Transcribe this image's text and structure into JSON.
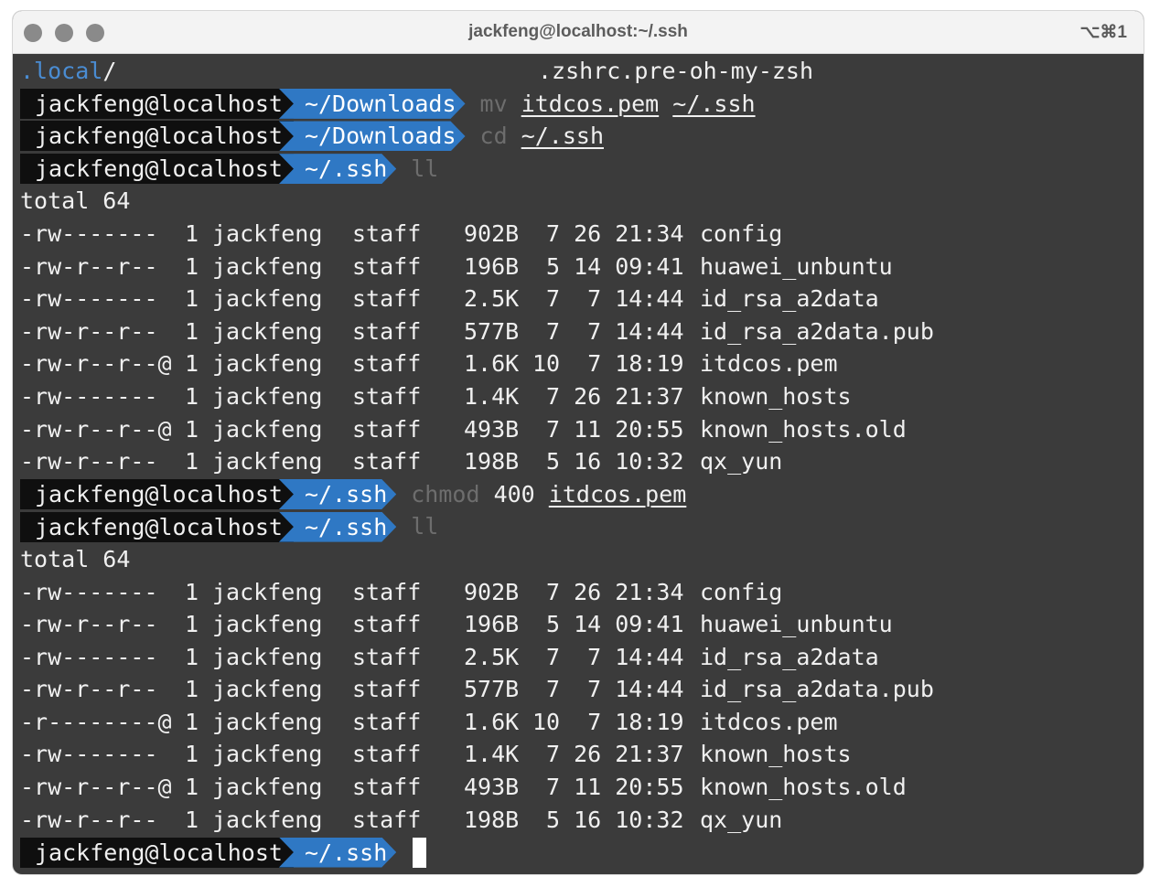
{
  "window": {
    "title": "jackfeng@localhost:~/.ssh",
    "shortcut": "⌥⌘1"
  },
  "colors": {
    "terminal_bg": "#3b3b3b",
    "prompt_user_bg": "#0f0f0f",
    "prompt_path_bg": "#2f78c4",
    "dim_command": "#6d6d6d"
  },
  "terminal": {
    "top_line": {
      "left": ".local",
      "left_slash": "/",
      "right": ".zshrc.pre-oh-my-zsh"
    },
    "prompts": [
      {
        "user": "jackfeng@localhost",
        "path": "~/Downloads",
        "cmd": "mv",
        "args": [
          "itdcos.pem",
          "~/.ssh"
        ]
      },
      {
        "user": "jackfeng@localhost",
        "path": "~/Downloads",
        "cmd": "cd",
        "args": [
          "~/.ssh"
        ]
      },
      {
        "user": "jackfeng@localhost",
        "path": "~/.ssh",
        "cmd": "ll",
        "args": []
      }
    ],
    "total_1": "total 64",
    "listing_1": [
      {
        "perm": "-rw-------",
        "links": "1",
        "user": "jackfeng",
        "group": "staff",
        "size": "902B",
        "date": "7 26 21:34",
        "name": "config",
        "underline": false
      },
      {
        "perm": "-rw-r--r--",
        "links": "1",
        "user": "jackfeng",
        "group": "staff",
        "size": "196B",
        "date": "5 14 09:41",
        "name": "huawei_unbuntu",
        "underline": false
      },
      {
        "perm": "-rw-------",
        "links": "1",
        "user": "jackfeng",
        "group": "staff",
        "size": "2.5K",
        "date": "7  7 14:44",
        "name": "id_rsa_a2data",
        "underline": false
      },
      {
        "perm": "-rw-r--r--",
        "links": "1",
        "user": "jackfeng",
        "group": "staff",
        "size": "577B",
        "date": "7  7 14:44",
        "name": "id_rsa_a2data.pub",
        "underline": false
      },
      {
        "perm": "-rw-r--r--@",
        "links": "1",
        "user": "jackfeng",
        "group": "staff",
        "size": "1.6K",
        "date": "10  7 18:19",
        "name": "itdcos.pem",
        "underline": false
      },
      {
        "perm": "-rw-------",
        "links": "1",
        "user": "jackfeng",
        "group": "staff",
        "size": "1.4K",
        "date": "7 26 21:37",
        "name": "known_hosts",
        "underline": false
      },
      {
        "perm": "-rw-r--r--@",
        "links": "1",
        "user": "jackfeng",
        "group": "staff",
        "size": "493B",
        "date": "7 11 20:55",
        "name": "known_hosts.old",
        "underline": false
      },
      {
        "perm": "-rw-r--r--",
        "links": "1",
        "user": "jackfeng",
        "group": "staff",
        "size": "198B",
        "date": "5 16 10:32",
        "name": "qx_yun",
        "underline": false
      }
    ],
    "prompts_2": [
      {
        "user": "jackfeng@localhost",
        "path": "~/.ssh",
        "cmd": "chmod",
        "args": [
          "400",
          "itdcos.pem"
        ]
      },
      {
        "user": "jackfeng@localhost",
        "path": "~/.ssh",
        "cmd": "ll",
        "args": []
      }
    ],
    "total_2": "total 64",
    "listing_2": [
      {
        "perm": "-rw-------",
        "links": "1",
        "user": "jackfeng",
        "group": "staff",
        "size": "902B",
        "date": "7 26 21:34",
        "name": "config"
      },
      {
        "perm": "-rw-r--r--",
        "links": "1",
        "user": "jackfeng",
        "group": "staff",
        "size": "196B",
        "date": "5 14 09:41",
        "name": "huawei_unbuntu"
      },
      {
        "perm": "-rw-------",
        "links": "1",
        "user": "jackfeng",
        "group": "staff",
        "size": "2.5K",
        "date": "7  7 14:44",
        "name": "id_rsa_a2data"
      },
      {
        "perm": "-rw-r--r--",
        "links": "1",
        "user": "jackfeng",
        "group": "staff",
        "size": "577B",
        "date": "7  7 14:44",
        "name": "id_rsa_a2data.pub"
      },
      {
        "perm": "-r--------@",
        "links": "1",
        "user": "jackfeng",
        "group": "staff",
        "size": "1.6K",
        "date": "10  7 18:19",
        "name": "itdcos.pem"
      },
      {
        "perm": "-rw-------",
        "links": "1",
        "user": "jackfeng",
        "group": "staff",
        "size": "1.4K",
        "date": "7 26 21:37",
        "name": "known_hosts"
      },
      {
        "perm": "-rw-r--r--@",
        "links": "1",
        "user": "jackfeng",
        "group": "staff",
        "size": "493B",
        "date": "7 11 20:55",
        "name": "known_hosts.old"
      },
      {
        "perm": "-rw-r--r--",
        "links": "1",
        "user": "jackfeng",
        "group": "staff",
        "size": "198B",
        "date": "5 16 10:32",
        "name": "qx_yun"
      }
    ],
    "final_prompt": {
      "user": "jackfeng@localhost",
      "path": "~/.ssh"
    }
  }
}
